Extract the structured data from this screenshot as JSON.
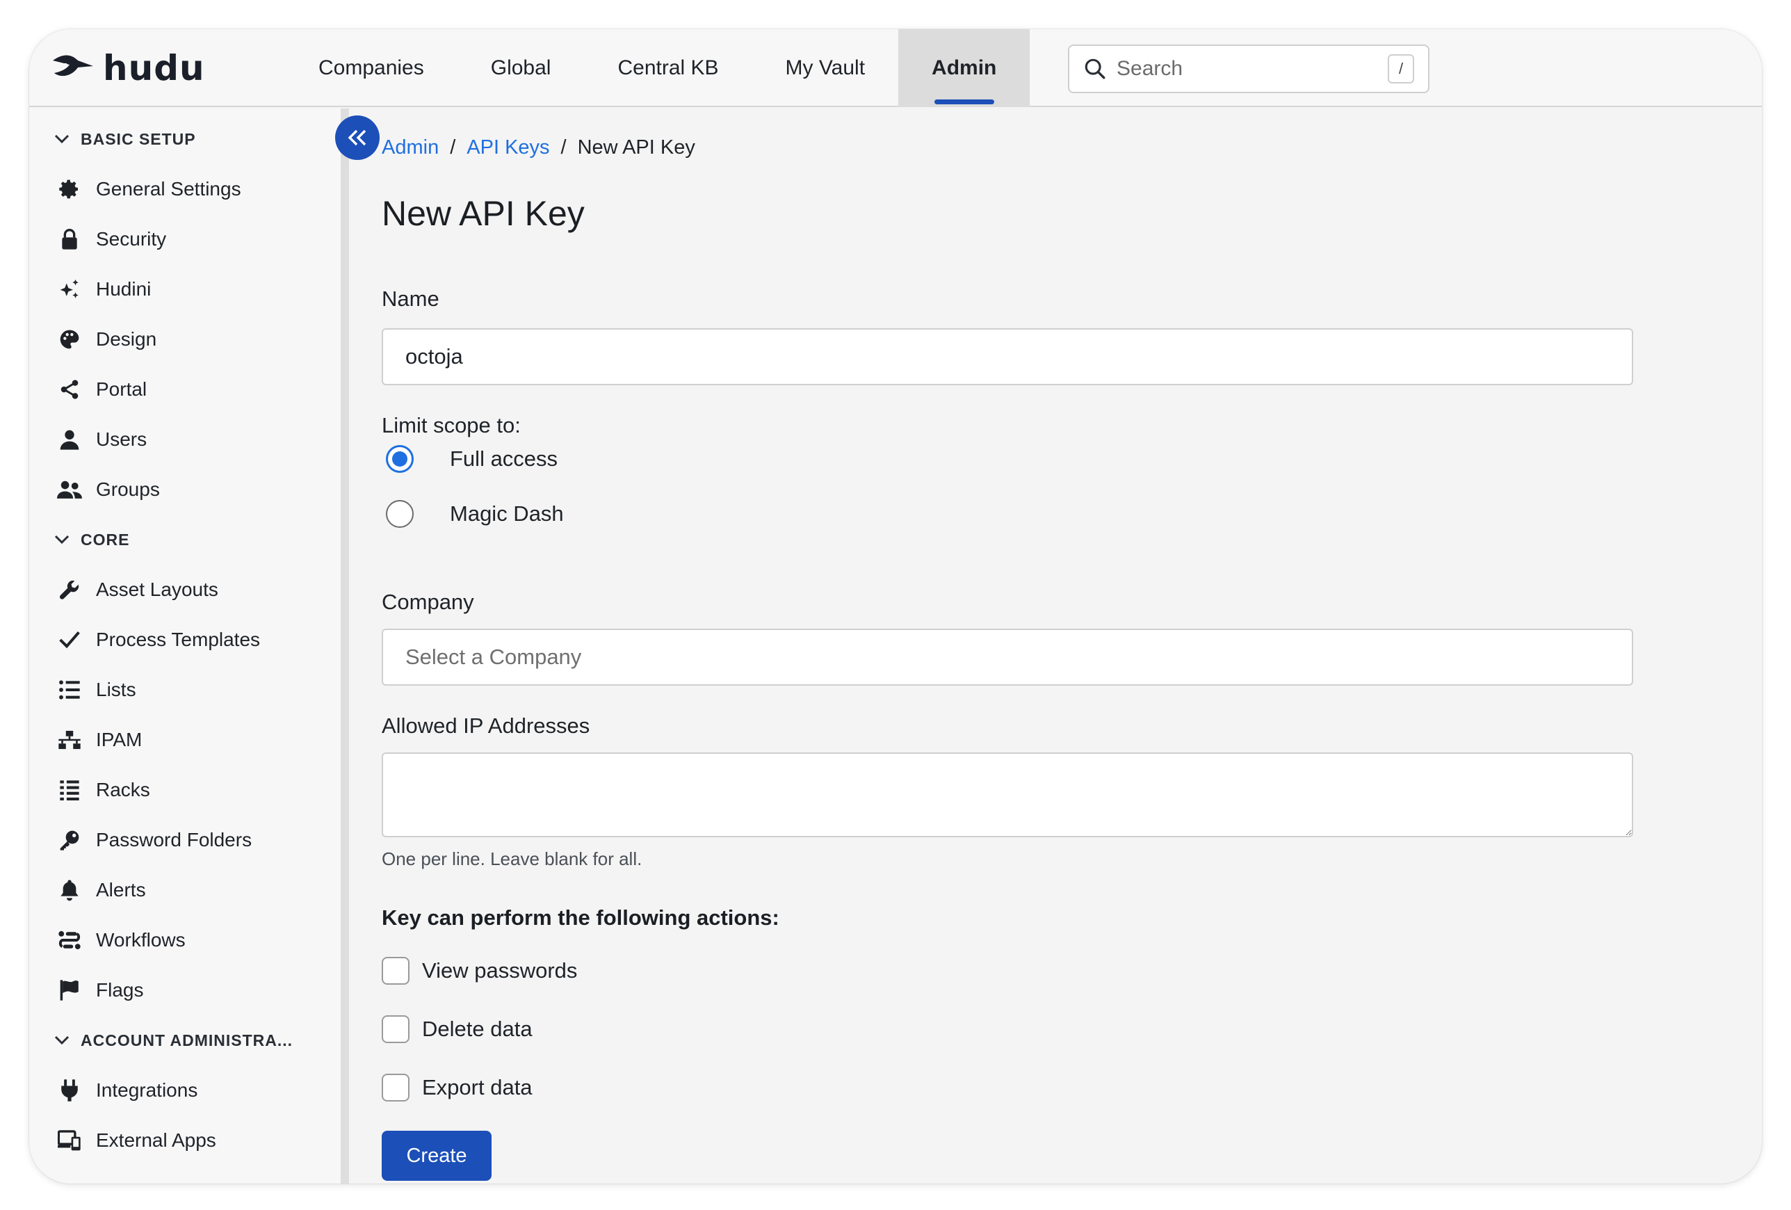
{
  "app": {
    "logo_text": "hudu"
  },
  "nav": {
    "items": [
      {
        "label": "Companies"
      },
      {
        "label": "Global"
      },
      {
        "label": "Central KB"
      },
      {
        "label": "My Vault"
      },
      {
        "label": "Admin",
        "active": true
      }
    ]
  },
  "search": {
    "placeholder": "Search",
    "shortcut": "/"
  },
  "sidebar": {
    "sections": [
      {
        "title": "BASIC SETUP",
        "items": [
          {
            "label": "General Settings",
            "icon": "gear-icon"
          },
          {
            "label": "Security",
            "icon": "lock-icon"
          },
          {
            "label": "Hudini",
            "icon": "sparkles-icon"
          },
          {
            "label": "Design",
            "icon": "palette-icon"
          },
          {
            "label": "Portal",
            "icon": "share-icon"
          },
          {
            "label": "Users",
            "icon": "user-icon"
          },
          {
            "label": "Groups",
            "icon": "users-icon"
          }
        ]
      },
      {
        "title": "CORE",
        "items": [
          {
            "label": "Asset Layouts",
            "icon": "wrench-icon"
          },
          {
            "label": "Process Templates",
            "icon": "check-icon"
          },
          {
            "label": "Lists",
            "icon": "list-icon"
          },
          {
            "label": "IPAM",
            "icon": "network-icon"
          },
          {
            "label": "Racks",
            "icon": "rack-icon"
          },
          {
            "label": "Password Folders",
            "icon": "key-icon"
          },
          {
            "label": "Alerts",
            "icon": "bell-icon"
          },
          {
            "label": "Workflows",
            "icon": "workflow-icon"
          },
          {
            "label": "Flags",
            "icon": "flag-icon"
          }
        ]
      },
      {
        "title": "ACCOUNT ADMINISTRA...",
        "items": [
          {
            "label": "Integrations",
            "icon": "plug-icon"
          },
          {
            "label": "External Apps",
            "icon": "external-apps-icon"
          }
        ]
      }
    ]
  },
  "breadcrumb": {
    "admin": "Admin",
    "api_keys": "API Keys",
    "current": "New API Key",
    "separator": "/"
  },
  "form": {
    "title": "New API Key",
    "name_label": "Name",
    "name_value": "octoja",
    "scope_label": "Limit scope to:",
    "scope_options": [
      {
        "label": "Full access",
        "checked": true
      },
      {
        "label": "Magic Dash",
        "checked": false
      }
    ],
    "company_label": "Company",
    "company_placeholder": "Select a Company",
    "ip_label": "Allowed IP Addresses",
    "ip_value": "",
    "ip_help": "One per line. Leave blank for all.",
    "actions_heading": "Key can perform the following actions:",
    "actions": [
      {
        "label": "View passwords",
        "checked": false
      },
      {
        "label": "Delete data",
        "checked": false
      },
      {
        "label": "Export data",
        "checked": false
      }
    ],
    "submit_label": "Create"
  },
  "colors": {
    "accent": "#1c4fb8",
    "link": "#1f6fe0",
    "radio": "#1f6fe0"
  }
}
